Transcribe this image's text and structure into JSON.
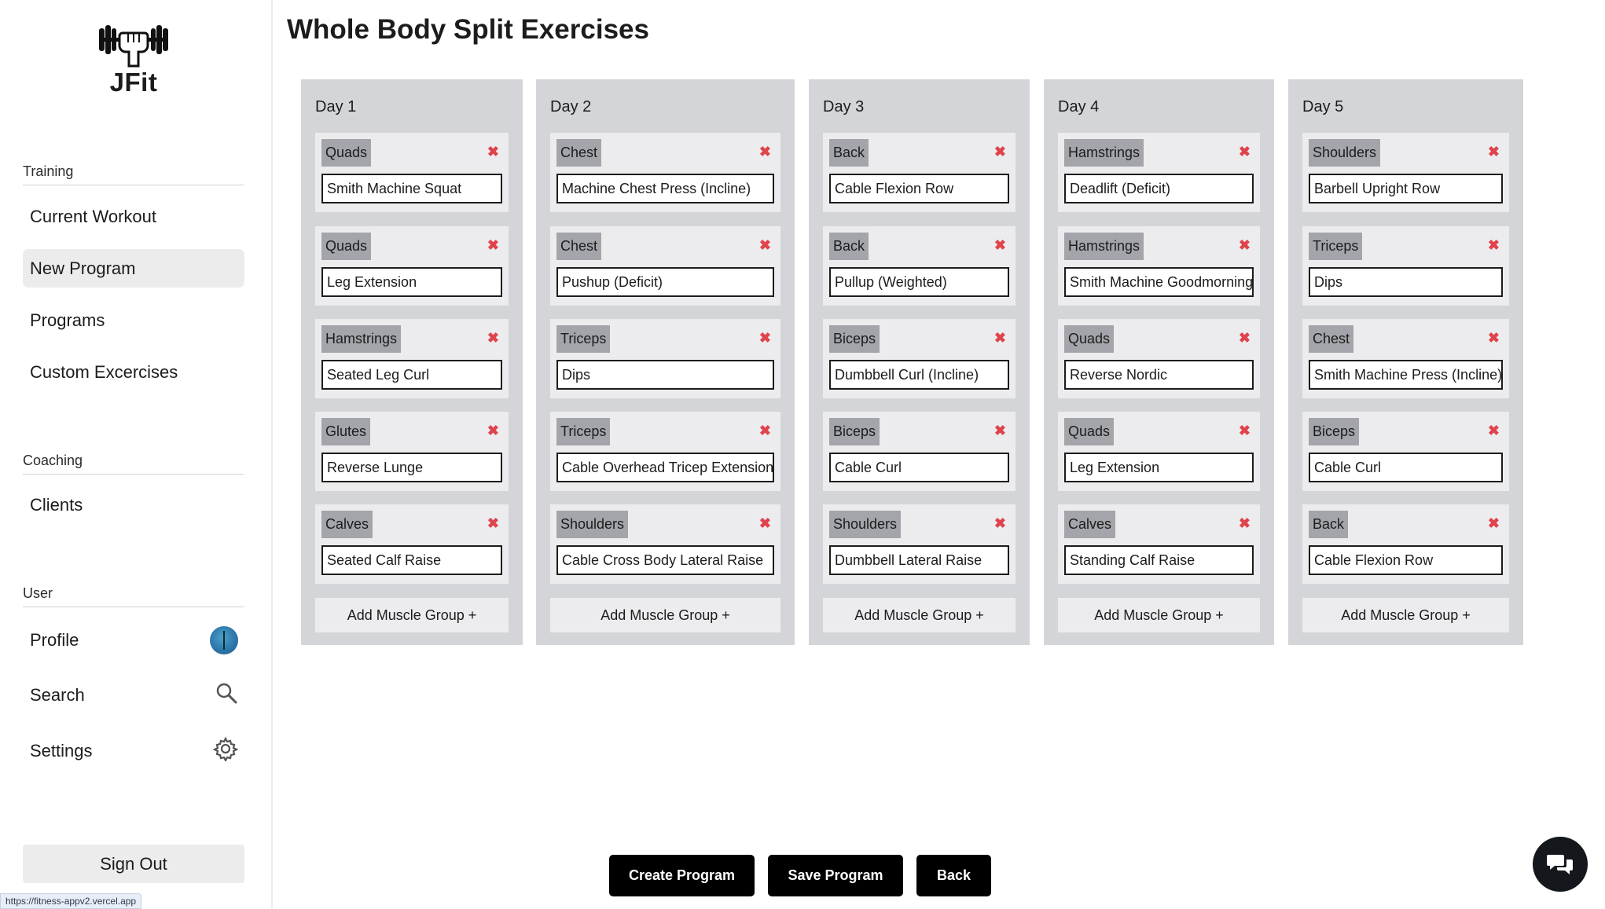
{
  "app": {
    "name": "JFit"
  },
  "sidebar": {
    "sections": {
      "training": "Training",
      "coaching": "Coaching",
      "user": "User"
    },
    "training_items": [
      "Current Workout",
      "New Program",
      "Programs",
      "Custom Excercises"
    ],
    "coaching_items": [
      "Clients"
    ],
    "user_items": [
      "Profile",
      "Search",
      "Settings"
    ],
    "active_item": "New Program",
    "sign_out": "Sign Out",
    "status_url": "https://fitness-appv2.vercel.app"
  },
  "page": {
    "title_bold": "Whole Body Split",
    "title_rest": " Exercises"
  },
  "days": [
    {
      "label": "Day 1",
      "exercises": [
        {
          "group": "Quads",
          "exercise": "Smith Machine Squat"
        },
        {
          "group": "Quads",
          "exercise": "Leg Extension"
        },
        {
          "group": "Hamstrings",
          "exercise": "Seated Leg Curl"
        },
        {
          "group": "Glutes",
          "exercise": "Reverse Lunge"
        },
        {
          "group": "Calves",
          "exercise": "Seated Calf Raise"
        }
      ],
      "add_label": "Add Muscle Group +"
    },
    {
      "label": "Day 2",
      "exercises": [
        {
          "group": "Chest",
          "exercise": "Machine Chest Press (Incline)"
        },
        {
          "group": "Chest",
          "exercise": "Pushup (Deficit)"
        },
        {
          "group": "Triceps",
          "exercise": "Dips"
        },
        {
          "group": "Triceps",
          "exercise": "Cable Overhead Tricep Extension"
        },
        {
          "group": "Shoulders",
          "exercise": "Cable Cross Body Lateral Raise"
        }
      ],
      "add_label": "Add Muscle Group +"
    },
    {
      "label": "Day 3",
      "exercises": [
        {
          "group": "Back",
          "exercise": "Cable Flexion Row"
        },
        {
          "group": "Back",
          "exercise": "Pullup (Weighted)"
        },
        {
          "group": "Biceps",
          "exercise": "Dumbbell Curl (Incline)"
        },
        {
          "group": "Biceps",
          "exercise": "Cable Curl"
        },
        {
          "group": "Shoulders",
          "exercise": "Dumbbell Lateral Raise"
        }
      ],
      "add_label": "Add Muscle Group +"
    },
    {
      "label": "Day 4",
      "exercises": [
        {
          "group": "Hamstrings",
          "exercise": "Deadlift (Deficit)"
        },
        {
          "group": "Hamstrings",
          "exercise": "Smith Machine Goodmorning"
        },
        {
          "group": "Quads",
          "exercise": "Reverse Nordic"
        },
        {
          "group": "Quads",
          "exercise": "Leg Extension"
        },
        {
          "group": "Calves",
          "exercise": "Standing Calf Raise"
        }
      ],
      "add_label": "Add Muscle Group +"
    },
    {
      "label": "Day 5",
      "exercises": [
        {
          "group": "Shoulders",
          "exercise": "Barbell Upright Row"
        },
        {
          "group": "Triceps",
          "exercise": "Dips"
        },
        {
          "group": "Chest",
          "exercise": "Smith Machine Press (Incline)"
        },
        {
          "group": "Biceps",
          "exercise": "Cable Curl"
        },
        {
          "group": "Back",
          "exercise": "Cable Flexion Row"
        }
      ],
      "add_label": "Add Muscle Group +"
    }
  ],
  "actions": {
    "create": "Create Program",
    "save": "Save Program",
    "back": "Back"
  },
  "icons": {
    "logo": "dumbbell-fist-icon",
    "delete": "red-x-icon",
    "search": "search-icon",
    "settings": "gear-icon",
    "chat": "chat-bubbles-icon"
  },
  "colors": {
    "delete": "#e0434b",
    "column_bg": "#d3d5d9",
    "tag_bg": "#a3a5ab",
    "button_bg": "#000000"
  }
}
